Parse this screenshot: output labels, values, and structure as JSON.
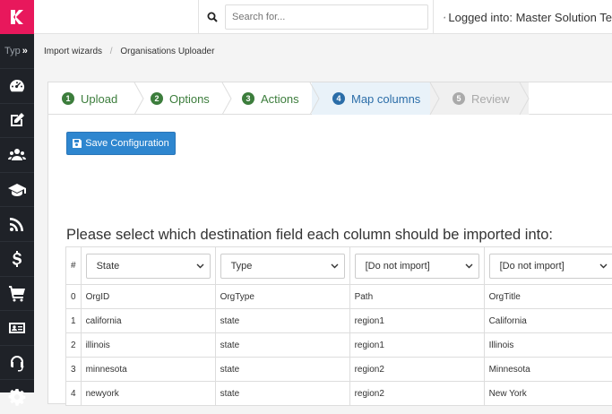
{
  "sidebar": {
    "type_label": "Typ",
    "expand_glyph": "»",
    "icons": [
      "dashboard-icon",
      "edit-icon",
      "users-icon",
      "graduation-cap-icon",
      "rss-icon",
      "dollar-icon",
      "cart-icon",
      "id-card-icon",
      "headset-icon",
      "settings-icon"
    ]
  },
  "topbar": {
    "search_placeholder": "Search for...",
    "user_text": "Logged into: Master Solution Te"
  },
  "breadcrumb": {
    "items": [
      "Import wizards",
      "Organisations Uploader"
    ]
  },
  "wizard": {
    "steps": [
      {
        "num": "1",
        "label": "Upload",
        "state": "done"
      },
      {
        "num": "2",
        "label": "Options",
        "state": "done"
      },
      {
        "num": "3",
        "label": "Actions",
        "state": "done"
      },
      {
        "num": "4",
        "label": "Map columns",
        "state": "active"
      },
      {
        "num": "5",
        "label": "Review",
        "state": "disabled"
      }
    ]
  },
  "save_button": {
    "label": "Save Configuration"
  },
  "instruction": "Please select which destination field each column should be imported into:",
  "table": {
    "hash": "#",
    "selects": [
      "State",
      "Type",
      "[Do not import]",
      "[Do not import]"
    ],
    "rows": [
      [
        "0",
        "OrgID",
        "OrgType",
        "Path",
        "OrgTitle"
      ],
      [
        "1",
        "california",
        "state",
        "region1",
        "California"
      ],
      [
        "2",
        "illinois",
        "state",
        "region1",
        "Illinois"
      ],
      [
        "3",
        "minnesota",
        "state",
        "region2",
        "Minnesota"
      ],
      [
        "4",
        "newyork",
        "state",
        "region2",
        "New York"
      ]
    ]
  },
  "colors": {
    "brand": "#e8185c",
    "sidebar": "#1f2228",
    "primary": "#2e86cf",
    "done": "#3c7d3c",
    "active": "#2b6da8"
  }
}
